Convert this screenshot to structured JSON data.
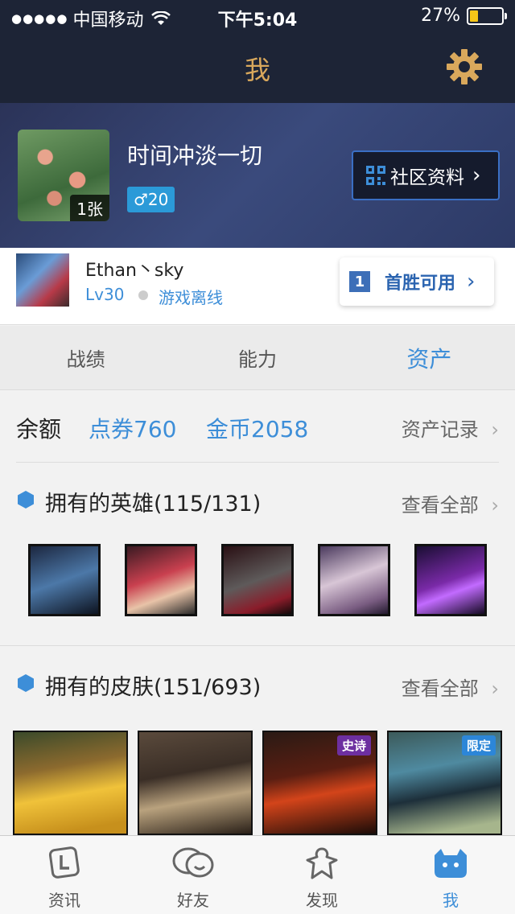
{
  "status_bar": {
    "carrier": "中国移动",
    "time": "下午5:04",
    "battery": "27%",
    "battery_level": 0.27
  },
  "nav": {
    "title": "我"
  },
  "profile": {
    "name": "时间冲淡一切",
    "photo_count": "1张",
    "gender_level": "♂20",
    "community_button": "社区资料"
  },
  "account": {
    "name": "Ethan丶sky",
    "level": "Lv30",
    "status": "游戏离线",
    "first_win_badge": "1",
    "first_win_label": "首胜可用"
  },
  "tabs": [
    {
      "label": "战绩",
      "active": false
    },
    {
      "label": "能力",
      "active": false
    },
    {
      "label": "资产",
      "active": true
    }
  ],
  "balance": {
    "label": "余额",
    "coupon": "点券760",
    "gold": "金币2058",
    "record": "资产记录"
  },
  "heroes_section": {
    "title": "拥有的英雄(115/131)",
    "view_all": "查看全部"
  },
  "skins_section": {
    "title": "拥有的皮肤(151/693)",
    "view_all": "查看全部"
  },
  "skins": [
    {
      "tag": ""
    },
    {
      "tag": ""
    },
    {
      "tag": "史诗"
    },
    {
      "tag": "限定"
    }
  ],
  "bottom_tabs": [
    {
      "label": "资讯",
      "icon": "news-icon"
    },
    {
      "label": "好友",
      "icon": "friends-icon"
    },
    {
      "label": "发现",
      "icon": "discover-icon"
    },
    {
      "label": "我",
      "icon": "me-icon",
      "active": true
    }
  ],
  "colors": {
    "accent": "#3d8ed8",
    "nav_bg": "#1d2436",
    "title_gold": "#d9a85c"
  }
}
